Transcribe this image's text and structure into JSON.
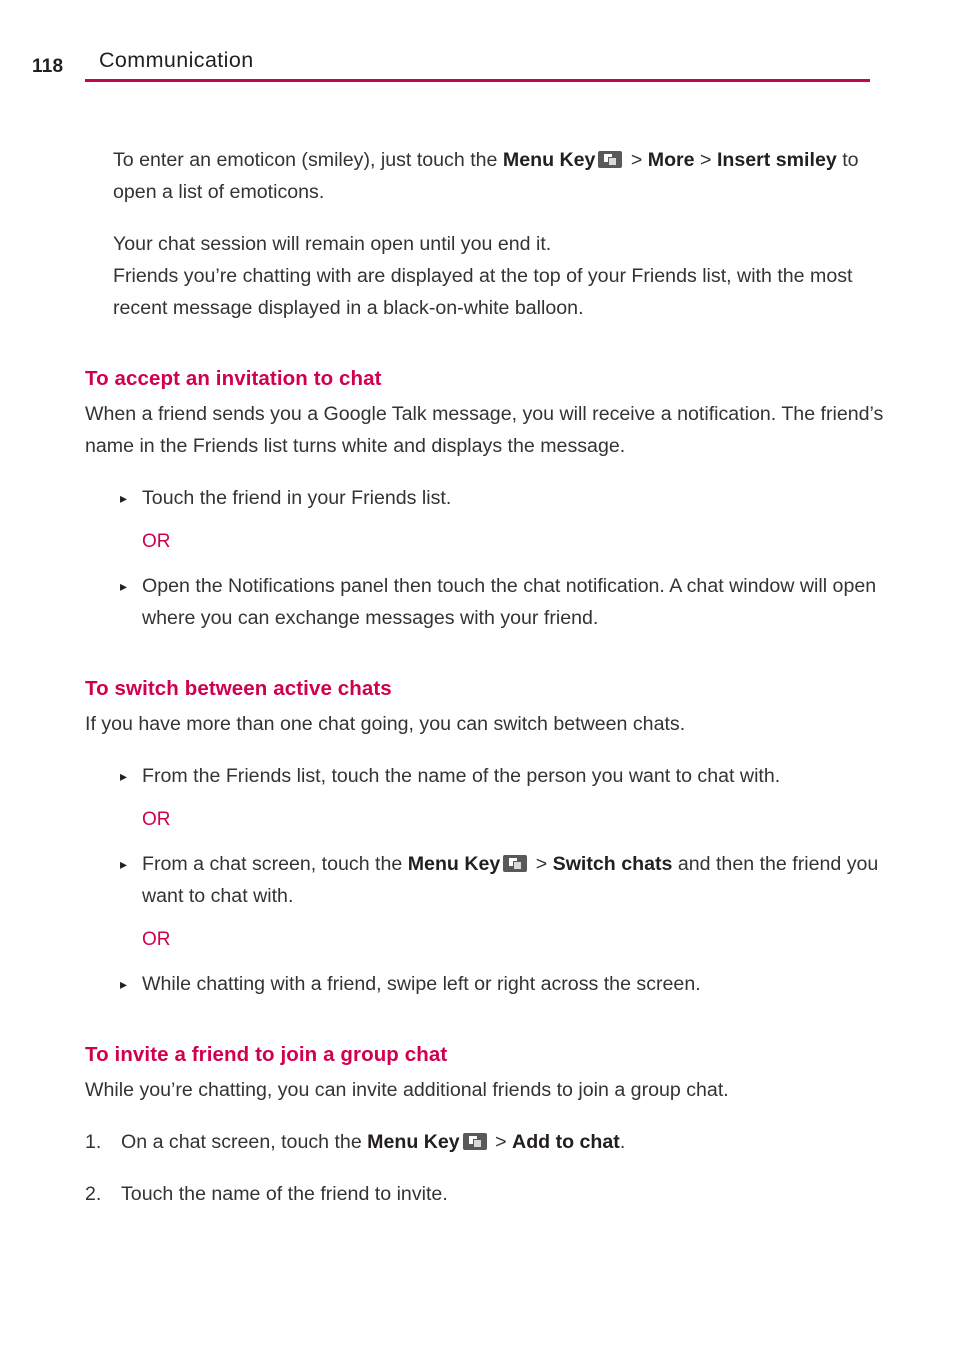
{
  "header": {
    "folio": "118",
    "running_head": "Communication",
    "rule_color": "#c40550"
  },
  "theme": {
    "accent": "#d1004f",
    "body_text": "#333333",
    "heading_text": "#231f20",
    "menu_key_bg": "#595959"
  },
  "icons": {
    "menu_key": "menu-key-icon",
    "bullet": "▸"
  },
  "intro": {
    "p1": {
      "t1": "To enter an emoticon (smiley), just touch the ",
      "b1": "Menu Key",
      "t2": " > ",
      "b2": "More",
      "t3": " > ",
      "b3": "Insert smiley",
      "t4": " to open a list of emoticons."
    },
    "p2_line1": "Your chat session will remain open until you end it.",
    "p2_line2": "Friends you’re chatting with are displayed at the top of your Friends list, with the most recent message displayed in a black-on-white balloon."
  },
  "sections": [
    {
      "heading": "To accept an invitation to chat",
      "body": "When a friend sends you a Google Talk message, you will receive a notification. The friend’s name in the Friends list turns white and displays the message.",
      "bullets": [
        "Touch the friend in your Friends list.",
        "Open the Notifications panel then touch the chat notification. A chat window will open where you can exchange messages with your friend."
      ],
      "or_label": "OR"
    },
    {
      "heading": "To switch between active chats",
      "body": "If you have more than one chat going, you can switch between chats.",
      "bullets": [
        "From the Friends list, touch the name of the person you want to chat with.",
        "While chatting with a friend, swipe left or right across the screen."
      ],
      "bullet_menu": {
        "t1": "From a chat screen, touch the ",
        "b1": "Menu Key",
        "t2": " > ",
        "b2": "Switch chats",
        "t3": " and then the friend you want to chat with."
      },
      "or_label": "OR",
      "or_label_2": "OR"
    },
    {
      "heading": "To invite a friend to join a group chat",
      "body": "While you’re chatting, you can invite additional friends to join a group chat.",
      "steps": [
        {
          "num": "1.",
          "t1": "On a chat screen, touch the ",
          "b1": "Menu Key",
          "t2": " > ",
          "b2": "Add to chat",
          "t3": "."
        },
        {
          "num": "2.",
          "text": "Touch the name of the friend to invite."
        }
      ]
    }
  ]
}
